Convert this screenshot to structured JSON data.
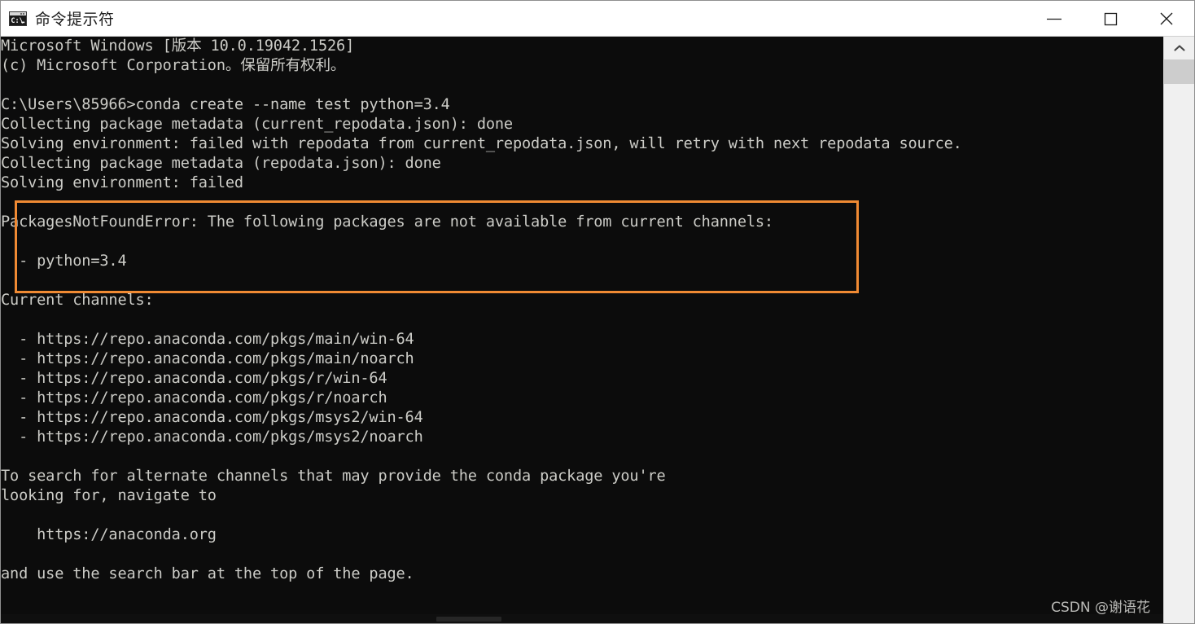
{
  "window": {
    "title": "命令提示符",
    "icon": "cmd-prompt-icon",
    "background_color": "#0c0c0c",
    "titlebar_color": "#ffffff",
    "text_color": "#ccccc7"
  },
  "window_controls": {
    "minimize_label": "最小化",
    "maximize_label": "最大化",
    "close_label": "关闭"
  },
  "terminal": {
    "prompt_path": "C:\\Users\\85966",
    "command": "conda create --name test python=3.4",
    "lines": [
      "Microsoft Windows [版本 10.0.19042.1526]",
      "(c) Microsoft Corporation。保留所有权利。",
      "",
      "C:\\Users\\85966>conda create --name test python=3.4",
      "Collecting package metadata (current_repodata.json): done",
      "Solving environment: failed with repodata from current_repodata.json, will retry with next repodata source.",
      "Collecting package metadata (repodata.json): done",
      "Solving environment: failed",
      "",
      "PackagesNotFoundError: The following packages are not available from current channels:",
      "",
      "  - python=3.4",
      "",
      "Current channels:",
      "",
      "  - https://repo.anaconda.com/pkgs/main/win-64",
      "  - https://repo.anaconda.com/pkgs/main/noarch",
      "  - https://repo.anaconda.com/pkgs/r/win-64",
      "  - https://repo.anaconda.com/pkgs/r/noarch",
      "  - https://repo.anaconda.com/pkgs/msys2/win-64",
      "  - https://repo.anaconda.com/pkgs/msys2/noarch",
      "",
      "To search for alternate channels that may provide the conda package you're",
      "looking for, navigate to",
      "",
      "    https://anaconda.org",
      "",
      "and use the search bar at the top of the page."
    ],
    "error_name": "PackagesNotFoundError",
    "error_message": "The following packages are not available from current channels:",
    "missing_package": "python=3.4",
    "channels": [
      "https://repo.anaconda.com/pkgs/main/win-64",
      "https://repo.anaconda.com/pkgs/main/noarch",
      "https://repo.anaconda.com/pkgs/r/win-64",
      "https://repo.anaconda.com/pkgs/r/noarch",
      "https://repo.anaconda.com/pkgs/msys2/win-64",
      "https://repo.anaconda.com/pkgs/msys2/noarch"
    ],
    "anaconda_url": "https://anaconda.org"
  },
  "annotation": {
    "highlight_color": "#f08a33",
    "highlight_target": "PackagesNotFoundError block"
  },
  "watermark": {
    "text": "CSDN @谢语花"
  }
}
